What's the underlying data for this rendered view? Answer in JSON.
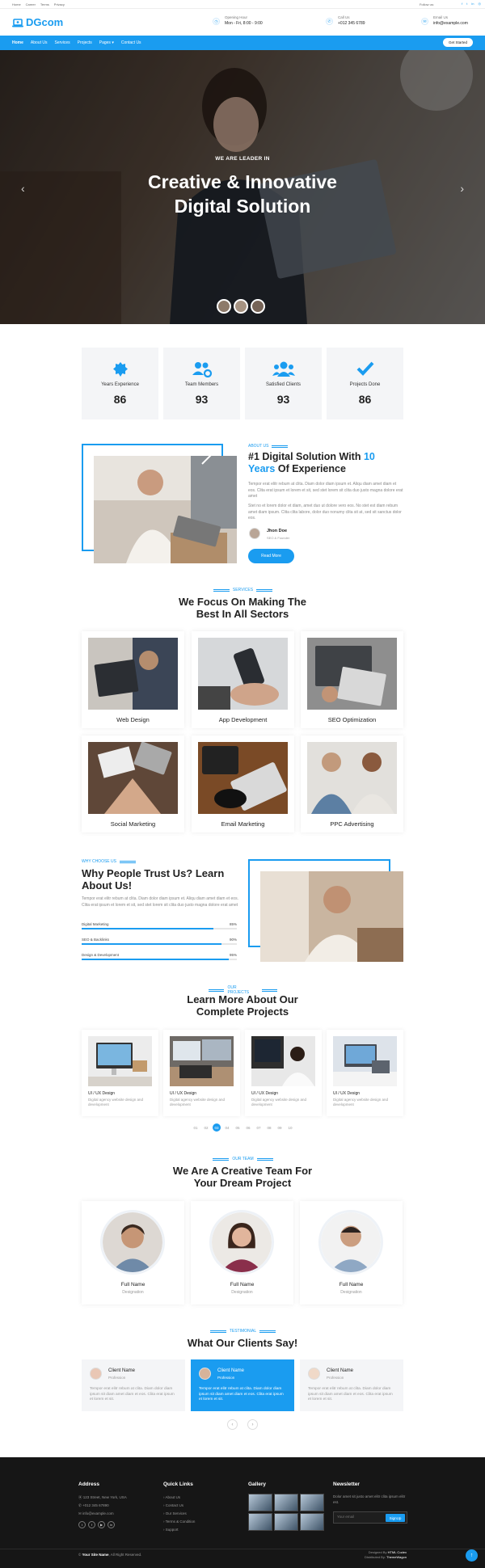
{
  "topbar": {
    "links": [
      "Home",
      "Career",
      "Terms",
      "Privacy"
    ],
    "follow": "Follow us:"
  },
  "brand": {
    "name": "DGcom"
  },
  "header": {
    "hours_label": "Opening Hour",
    "hours": "Mon - Fri, 8:00 - 9:00",
    "call_label": "Call Us",
    "phone": "+012 345 6789",
    "email_label": "Email Us",
    "email": "info@example.com"
  },
  "nav": {
    "items": [
      "Home",
      "About Us",
      "Services",
      "Projects",
      "Pages",
      "Contact Us"
    ],
    "cta": "Get Started"
  },
  "hero": {
    "subtitle": "WE ARE LEADER IN",
    "title_line1": "Creative & Innovative",
    "title_line2": "Digital Solution"
  },
  "stats": [
    {
      "label": "Years Experience",
      "value": "86",
      "icon": "award-icon"
    },
    {
      "label": "Team Members",
      "value": "93",
      "icon": "users-cog-icon"
    },
    {
      "label": "Satisfied Clients",
      "value": "93",
      "icon": "users-icon"
    },
    {
      "label": "Projects Done",
      "value": "86",
      "icon": "check-icon"
    }
  ],
  "about": {
    "tag": "ABOUT US",
    "title_a": "#1 Digital Solution With ",
    "title_b": "10",
    "title_c": "Years",
    "title_d": " Of Experience",
    "p1": "Tempor erat elitr rebum at clita. Diam dolor diam ipsum et. Aliqu diam amet diam et eos. Clita erat ipsum et lorem et sit, sed stet lorem sit clita duo justo magna dolore erat amet",
    "p2": "Stet no et lorem dolor et diam, amet duo ut dolore vero eos. No stet est diam rebum amet diam ipsum. Clita clita labore, dolor duo nonumy clita sit at, sed sit sanctus dolor eos.",
    "person_name": "Jhon Doe",
    "person_role": "SEO & Founder",
    "button": "Read More"
  },
  "services": {
    "tag": "SERVICES",
    "title_l1": "We Focus On Making The",
    "title_l2": "Best In All Sectors",
    "items": [
      "Web Design",
      "App Development",
      "SEO Optimization",
      "Social Marketing",
      "Email Marketing",
      "PPC Advertising"
    ]
  },
  "why": {
    "tag": "WHY CHOOSE US",
    "title_l1": "Why People Trust Us? Learn",
    "title_l2": "About Us!",
    "text": "Tempor erat elitr rebum at clita. Diam dolor diam ipsum et. Aliqu diam amet diam et eos. Clita erat ipsum et lorem et sit, sed stet lorem sit clita duo justo magna dolore erat amet",
    "bars": [
      {
        "label": "Digital Marketing",
        "value": "85%",
        "pct": 85
      },
      {
        "label": "SEO & Backlinks",
        "value": "90%",
        "pct": 90
      },
      {
        "label": "Design & Development",
        "value": "95%",
        "pct": 95
      }
    ]
  },
  "projects": {
    "tag": "OUR PROJECTS",
    "title_l1": "Learn More About Our",
    "title_l2": "Complete Projects",
    "items": [
      {
        "title": "UI / UX Design",
        "desc": "Digital agency website design and development"
      },
      {
        "title": "UI / UX Design",
        "desc": "Digital agency website design and development"
      },
      {
        "title": "UI / UX Design",
        "desc": "Digital agency website design and development"
      },
      {
        "title": "UI / UX Design",
        "desc": "Digital agency website design and development"
      }
    ],
    "pages": [
      "01",
      "02",
      "03",
      "04",
      "05",
      "06",
      "07",
      "08",
      "09",
      "10"
    ]
  },
  "team": {
    "tag": "OUR TEAM",
    "title_l1": "We Are A Creative Team For",
    "title_l2": "Your Dream Project",
    "members": [
      {
        "name": "Full Name",
        "role": "Designation"
      },
      {
        "name": "Full Name",
        "role": "Designation"
      },
      {
        "name": "Full Name",
        "role": "Designation"
      }
    ]
  },
  "testimonial": {
    "tag": "TESTIMONIAL",
    "title": "What Our Clients Say!",
    "items": [
      {
        "name": "Client Name",
        "role": "Profession",
        "text": "Tempor erat elitr rebum at clita. Diam dolor diam ipsum sit diam amet diam et eos. Clita erat ipsum et lorem et sit."
      },
      {
        "name": "Client Name",
        "role": "Profession",
        "text": "Tempor erat elitr rebum at clita. Diam dolor diam ipsum sit diam amet diam et eos. Clita erat ipsum et lorem et sit."
      },
      {
        "name": "Client Name",
        "role": "Profession",
        "text": "Tempor erat elitr rebum at clita. Diam dolor diam ipsum sit diam amet diam et eos. Clita erat ipsum et lorem et sit."
      }
    ]
  },
  "footer": {
    "address_title": "Address",
    "address": "123 Street, New York, USA",
    "phone": "+012 345 67890",
    "email": "info@example.com",
    "links_title": "Quick Links",
    "links": [
      "About Us",
      "Contact Us",
      "Our Services",
      "Terms & Condition",
      "Support"
    ],
    "gallery_title": "Gallery",
    "news_title": "Newsletter",
    "news_text": "Dolor amet sit justo amet elitr clita ipsum elitr est.",
    "email_placeholder": "Your email",
    "signup": "SignUp",
    "copyright_name": "Your Site Name",
    "copyright_rest": ", All Right Reserved.",
    "designed_pre": "Designed By ",
    "designed_by": "HTML Codex",
    "dist_pre": "Distributed By: ",
    "dist_by": "ThemeWagon"
  },
  "colors": {
    "accent": "#1a9cf0",
    "footer_bg": "#161616"
  }
}
